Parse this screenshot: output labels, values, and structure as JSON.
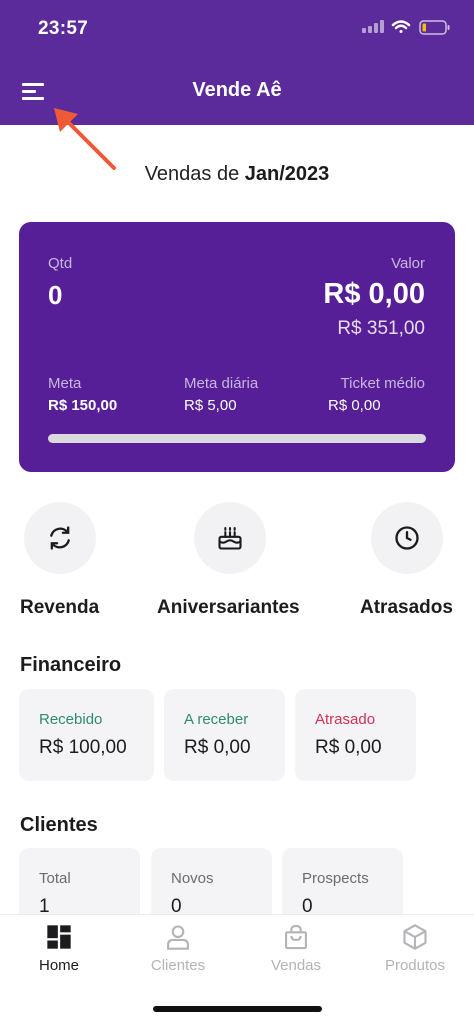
{
  "status_bar": {
    "time": "23:57"
  },
  "header": {
    "title": "Vende Aê"
  },
  "period": {
    "prefix": "Vendas de",
    "month": "Jan/2023"
  },
  "summary": {
    "qtd_label": "Qtd",
    "qtd_value": "0",
    "valor_label": "Valor",
    "valor_value": "R$ 0,00",
    "valor_secondary": "R$ 351,00",
    "meta_label": "Meta",
    "meta_value": "R$ 150,00",
    "meta_diaria_label": "Meta diária",
    "meta_diaria_value": "R$ 5,00",
    "ticket_label": "Ticket médio",
    "ticket_value": "R$ 0,00",
    "progress_fraction": 0
  },
  "shortcuts": [
    {
      "label": "Revenda",
      "icon": "refresh-icon"
    },
    {
      "label": "Aniversariantes",
      "icon": "birthday-cake-icon"
    },
    {
      "label": "Atrasados",
      "icon": "clock-icon"
    }
  ],
  "financeiro": {
    "title": "Financeiro",
    "cards": [
      {
        "label": "Recebido",
        "value": "R$ 100,00",
        "color": "#2e8b6e"
      },
      {
        "label": "A receber",
        "value": "R$ 0,00",
        "color": "#2e8b6e"
      },
      {
        "label": "Atrasado",
        "value": "R$ 0,00",
        "color": "#d2314f"
      }
    ]
  },
  "clientes": {
    "title": "Clientes",
    "cards": [
      {
        "label": "Total",
        "value": "1"
      },
      {
        "label": "Novos",
        "value": "0"
      },
      {
        "label": "Prospects",
        "value": "0"
      }
    ]
  },
  "bottom_nav": [
    {
      "label": "Home",
      "icon": "home-grid-icon",
      "active": true
    },
    {
      "label": "Clientes",
      "icon": "person-icon",
      "active": false
    },
    {
      "label": "Vendas",
      "icon": "shopping-bag-icon",
      "active": false
    },
    {
      "label": "Produtos",
      "icon": "box-icon",
      "active": false
    }
  ],
  "colors": {
    "primary": "#5b2a9b",
    "card": "#561f97",
    "annotation_arrow": "#ee5a36"
  }
}
